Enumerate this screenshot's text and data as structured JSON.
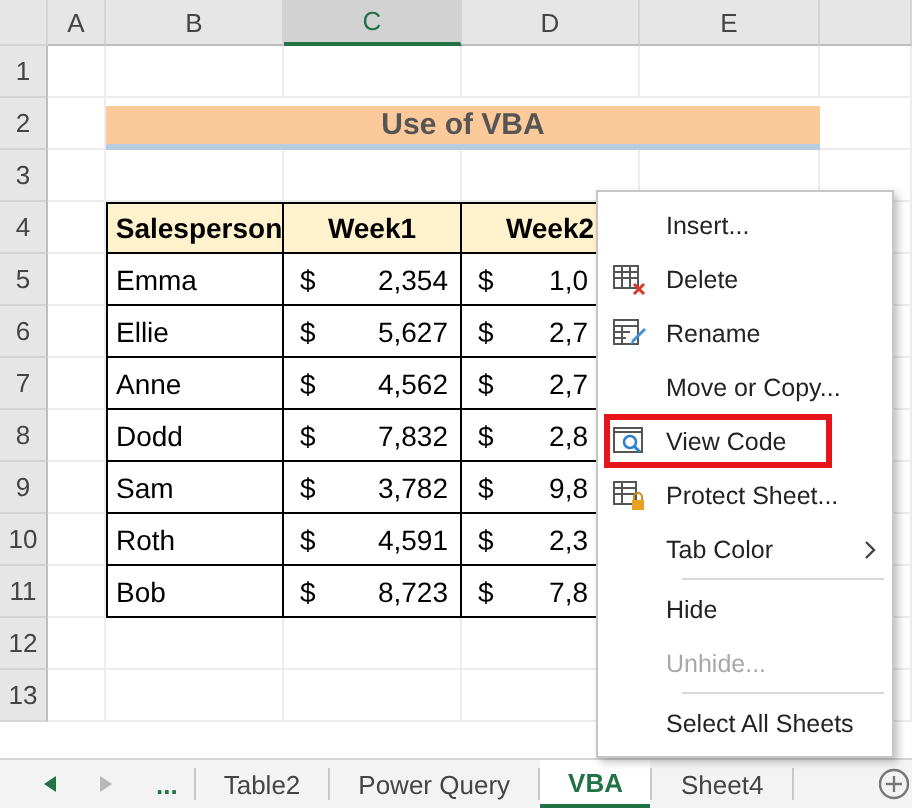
{
  "column_headers": [
    {
      "label": "A",
      "selected": false
    },
    {
      "label": "B",
      "selected": false
    },
    {
      "label": "C",
      "selected": true
    },
    {
      "label": "D",
      "selected": false
    },
    {
      "label": "E",
      "selected": false
    }
  ],
  "row_headers": [
    "1",
    "2",
    "3",
    "4",
    "5",
    "6",
    "7",
    "8",
    "9",
    "10",
    "11",
    "12",
    "13"
  ],
  "title": "Use of VBA",
  "table": {
    "columns": [
      "Salesperson",
      "Week1",
      "Week2"
    ],
    "rows": [
      {
        "salesperson": "Emma",
        "week1_currency": "$",
        "week1": "2,354",
        "week2_currency": "$",
        "week2": "1,0"
      },
      {
        "salesperson": "Ellie",
        "week1_currency": "$",
        "week1": "5,627",
        "week2_currency": "$",
        "week2": "2,7"
      },
      {
        "salesperson": "Anne",
        "week1_currency": "$",
        "week1": "4,562",
        "week2_currency": "$",
        "week2": "2,7"
      },
      {
        "salesperson": "Dodd",
        "week1_currency": "$",
        "week1": "7,832",
        "week2_currency": "$",
        "week2": "2,8"
      },
      {
        "salesperson": "Sam",
        "week1_currency": "$",
        "week1": "3,782",
        "week2_currency": "$",
        "week2": "9,8"
      },
      {
        "salesperson": "Roth",
        "week1_currency": "$",
        "week1": "4,591",
        "week2_currency": "$",
        "week2": "2,3"
      },
      {
        "salesperson": "Bob",
        "week1_currency": "$",
        "week1": "8,723",
        "week2_currency": "$",
        "week2": "7,8"
      }
    ]
  },
  "context_menu": [
    {
      "kind": "plain",
      "label": "Insert...",
      "disabled": false,
      "highlighted": false
    },
    {
      "kind": "delete",
      "label": "Delete",
      "disabled": false,
      "highlighted": false
    },
    {
      "kind": "rename",
      "label": "Rename",
      "disabled": false,
      "highlighted": false
    },
    {
      "kind": "plain",
      "label": "Move or Copy...",
      "disabled": false,
      "highlighted": false
    },
    {
      "kind": "view-code",
      "label": "View Code",
      "disabled": false,
      "highlighted": true
    },
    {
      "kind": "protect",
      "label": "Protect Sheet...",
      "disabled": false,
      "highlighted": false
    },
    {
      "kind": "submenu",
      "label": "Tab Color",
      "disabled": false,
      "highlighted": false
    },
    {
      "kind": "separator"
    },
    {
      "kind": "plain",
      "label": "Hide",
      "disabled": false,
      "highlighted": false
    },
    {
      "kind": "plain",
      "label": "Unhide...",
      "disabled": true,
      "highlighted": false
    },
    {
      "kind": "separator"
    },
    {
      "kind": "plain",
      "label": "Select All Sheets",
      "disabled": false,
      "highlighted": false
    }
  ],
  "sheet_tabs": {
    "more": "...",
    "tabs": [
      {
        "label": "Table2",
        "selected": false
      },
      {
        "label": "Power Query",
        "selected": false
      },
      {
        "label": "VBA",
        "selected": true
      },
      {
        "label": "Sheet4",
        "selected": false
      }
    ]
  }
}
